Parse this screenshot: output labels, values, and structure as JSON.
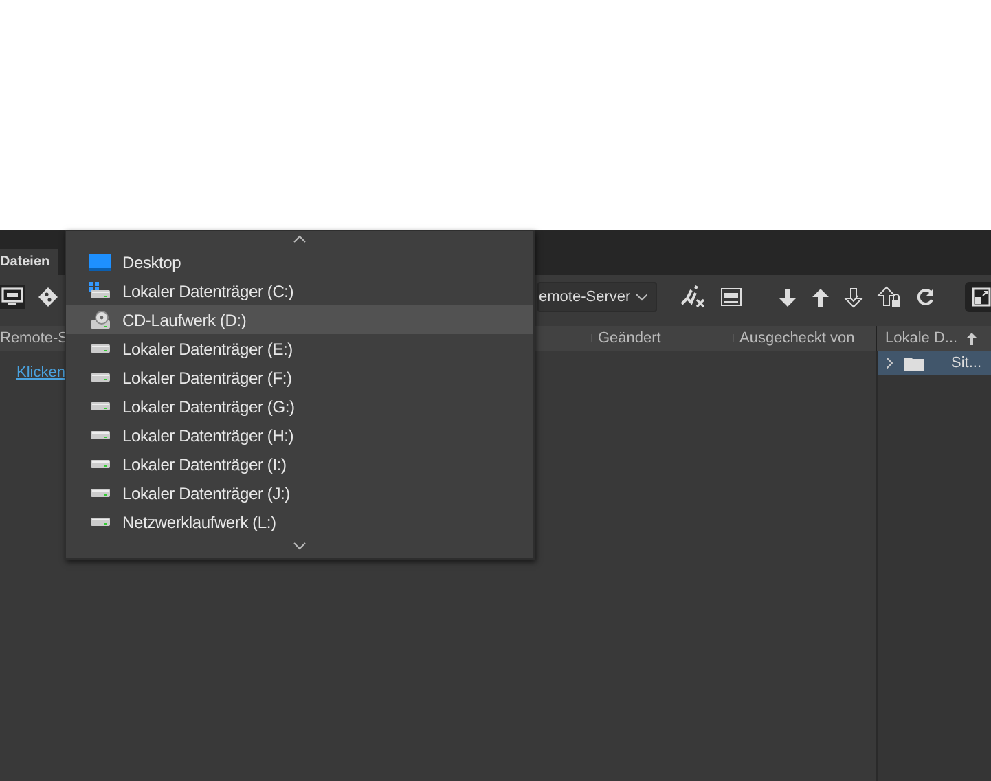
{
  "panel": {
    "tab": {
      "label": "Dateien",
      "selected": true
    },
    "server_select": {
      "value": "emote-Server"
    },
    "columns": [
      "Remote-S",
      "Geändert",
      "Ausgecheckt von"
    ],
    "link": "Klicken",
    "local_panel": {
      "column": "Lokale D...",
      "rows": [
        {
          "label": "Sit...",
          "selected": true
        }
      ]
    }
  },
  "dropdown": {
    "items": [
      {
        "kind": "desktop",
        "label": "Desktop",
        "selected": false
      },
      {
        "kind": "system",
        "label": "Lokaler Datenträger (C:)",
        "selected": false
      },
      {
        "kind": "cd",
        "label": "CD-Laufwerk (D:)",
        "selected": true
      },
      {
        "kind": "drive",
        "label": "Lokaler Datenträger (E:)",
        "selected": false
      },
      {
        "kind": "drive",
        "label": "Lokaler Datenträger (F:)",
        "selected": false
      },
      {
        "kind": "drive",
        "label": "Lokaler Datenträger (G:)",
        "selected": false
      },
      {
        "kind": "drive",
        "label": "Lokaler Datenträger (H:)",
        "selected": false
      },
      {
        "kind": "drive",
        "label": "Lokaler Datenträger (I:)",
        "selected": false
      },
      {
        "kind": "drive",
        "label": "Lokaler Datenträger (J:)",
        "selected": false
      },
      {
        "kind": "network",
        "label": "Netzwerklaufwerk (L:)",
        "selected": false
      }
    ]
  }
}
